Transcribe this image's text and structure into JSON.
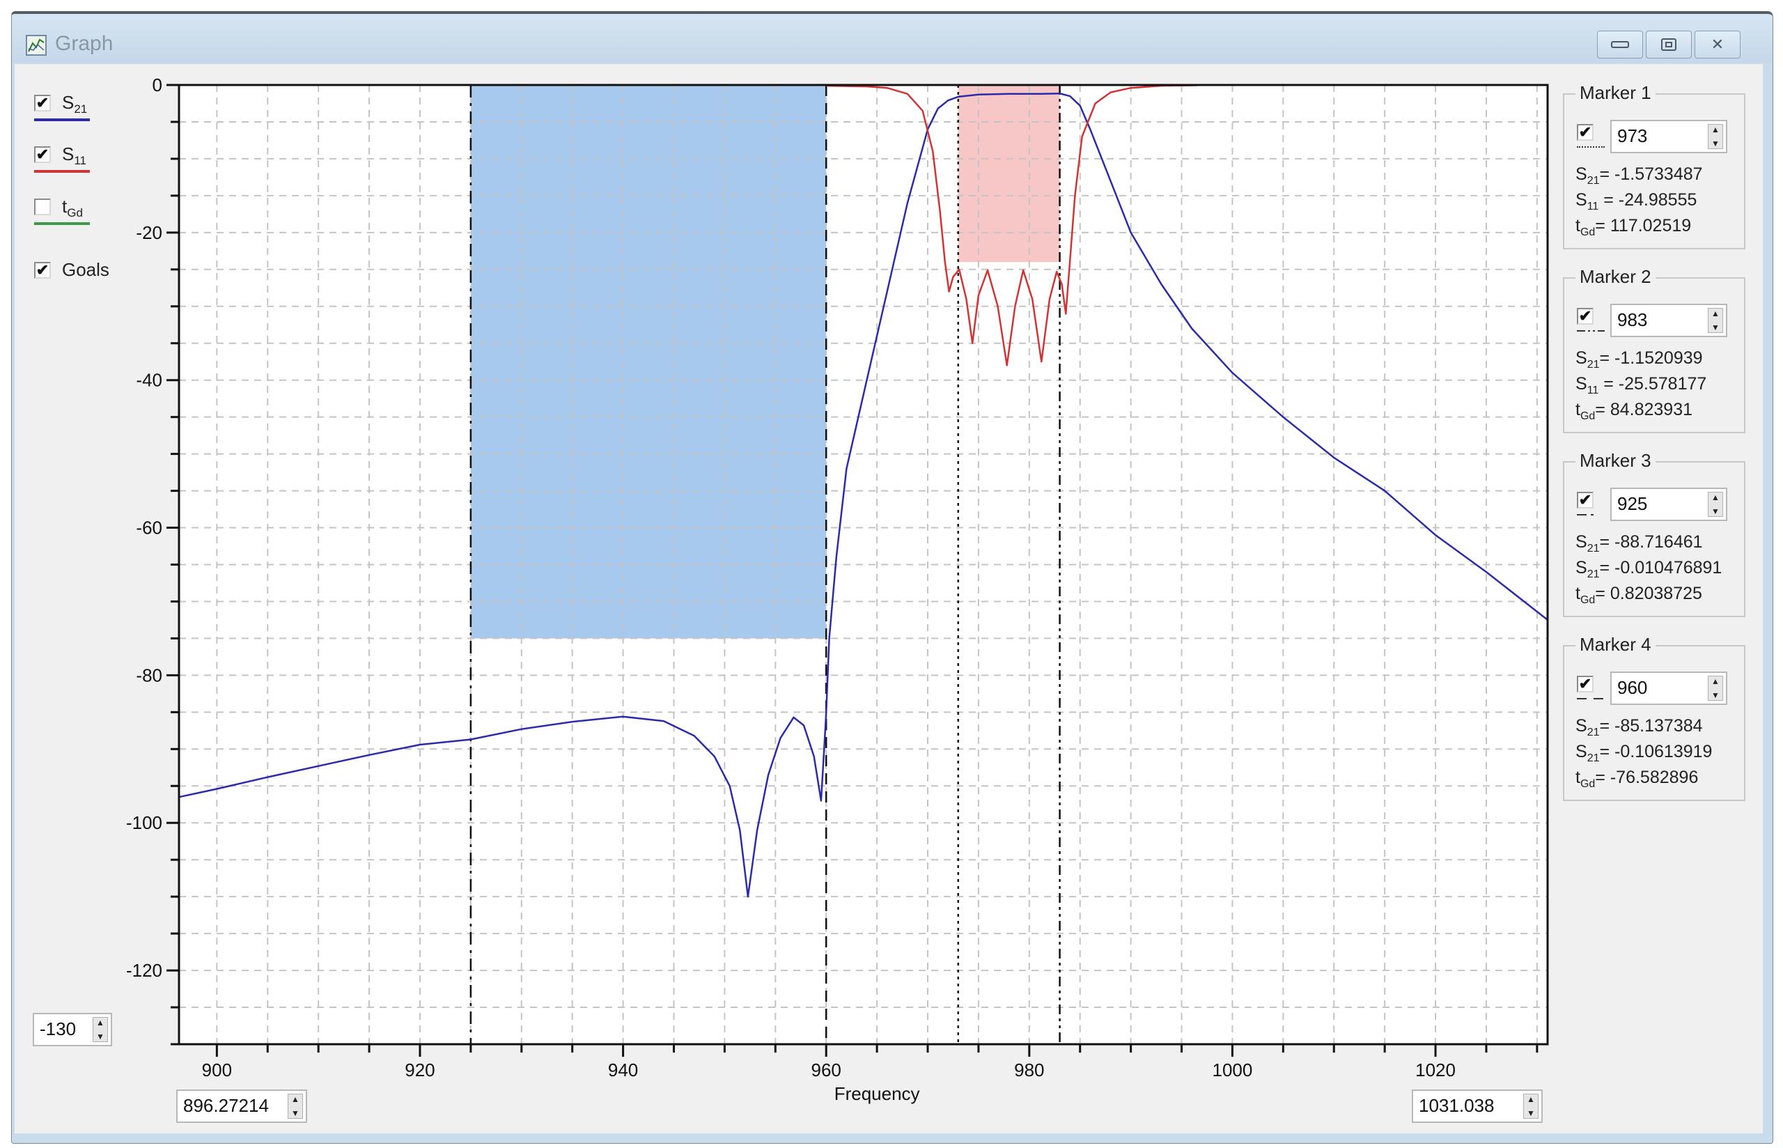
{
  "window": {
    "title": "Graph",
    "icon": "graph-chart-icon",
    "controls": {
      "minimize": "minimize-icon",
      "maximize": "maximize-icon",
      "close": "close-icon"
    }
  },
  "legend": [
    {
      "label": "S",
      "sub": "21",
      "checked": true,
      "color": "#2b2ba8"
    },
    {
      "label": "S",
      "sub": "11",
      "checked": true,
      "color": "#d03434"
    },
    {
      "label": "t",
      "sub": "Gd",
      "checked": false,
      "color": "#3a9a4a"
    },
    {
      "label": "Goals",
      "sub": "",
      "checked": true,
      "color": ""
    }
  ],
  "check_glyph": "✔",
  "axis_controls": {
    "y_min": "-130",
    "x_min": "896.27214",
    "x_max": "1031.038",
    "spin_up": "▲",
    "spin_down": "▼"
  },
  "markers": [
    {
      "title": "Marker 1",
      "checked": true,
      "value": "973",
      "dash": "dotted",
      "rows": [
        {
          "name": "S",
          "sub": "21",
          "text": "= -1.5733487"
        },
        {
          "name": "S",
          "sub": "11",
          "text": " = -24.98555"
        },
        {
          "name": "t",
          "sub": "Gd",
          "text": "= 117.02519"
        }
      ]
    },
    {
      "title": "Marker 2",
      "checked": true,
      "value": "983",
      "dash": "dash-dot-dot",
      "rows": [
        {
          "name": "S",
          "sub": "21",
          "text": "= -1.1520939"
        },
        {
          "name": "S",
          "sub": "11",
          "text": " = -25.578177"
        },
        {
          "name": "t",
          "sub": "Gd",
          "text": "= 84.823931"
        }
      ]
    },
    {
      "title": "Marker 3",
      "checked": true,
      "value": "925",
      "dash": "dash-dot",
      "rows": [
        {
          "name": "S",
          "sub": "21",
          "text": "= -88.716461"
        },
        {
          "name": "S",
          "sub": "21",
          "text": "= -0.010476891"
        },
        {
          "name": "t",
          "sub": "Gd",
          "text": "= 0.82038725"
        }
      ]
    },
    {
      "title": "Marker 4",
      "checked": true,
      "value": "960",
      "dash": "dashed",
      "rows": [
        {
          "name": "S",
          "sub": "21",
          "text": "= -85.137384"
        },
        {
          "name": "S",
          "sub": "21",
          "text": "= -0.10613919"
        },
        {
          "name": "t",
          "sub": "Gd",
          "text": "= -76.582896"
        }
      ]
    }
  ],
  "chart_data": {
    "type": "line",
    "title": "",
    "xlabel": "Frequency",
    "ylabel": "",
    "xlim": [
      896.27214,
      1031.038
    ],
    "ylim": [
      -130,
      0
    ],
    "x_ticks": [
      900,
      920,
      940,
      960,
      980,
      1000,
      1020
    ],
    "x_minor_step": 5,
    "y_ticks": [
      0,
      -20,
      -40,
      -60,
      -80,
      -100,
      -120
    ],
    "y_minor_step": 5,
    "grid": true,
    "series": [
      {
        "name": "S21",
        "color": "#2b2ba8",
        "x": [
          896.27,
          900,
          905,
          910,
          915,
          920,
          925,
          930,
          935,
          940,
          944,
          947,
          949,
          950.5,
          951.5,
          952.3,
          953.2,
          954.3,
          955.5,
          956.8,
          957.8,
          958.8,
          959.5,
          959.8,
          960,
          960.3,
          961,
          962,
          964,
          966,
          968,
          970,
          971,
          972,
          973,
          975,
          978,
          981,
          983,
          984,
          985,
          986,
          988,
          990,
          993,
          996,
          1000,
          1005,
          1010,
          1015,
          1020,
          1025,
          1031.04
        ],
        "y": [
          -96.5,
          -95.4,
          -93.8,
          -92.3,
          -90.8,
          -89.4,
          -88.7,
          -87.3,
          -86.3,
          -85.6,
          -86.2,
          -88.2,
          -91,
          -95,
          -101,
          -110,
          -101,
          -93.5,
          -88.5,
          -85.7,
          -86.8,
          -91,
          -97,
          -90,
          -85.1,
          -75,
          -64,
          -52,
          -40,
          -28,
          -16,
          -6,
          -3.2,
          -2.1,
          -1.6,
          -1.3,
          -1.2,
          -1.2,
          -1.15,
          -1.5,
          -2.8,
          -6,
          -13,
          -20,
          -27,
          -33,
          -39,
          -45,
          -50.5,
          -55,
          -61,
          -66,
          -72.5
        ]
      },
      {
        "name": "S11",
        "color": "#d03434",
        "x": [
          960,
          964,
          966,
          968,
          969.5,
          970.5,
          971.2,
          971.7,
          972.1,
          972.5,
          973.1,
          973.8,
          974.4,
          975,
          975.9,
          976.9,
          977.8,
          978.6,
          979.4,
          980.3,
          981.2,
          982,
          982.7,
          983.2,
          983.6,
          984,
          984.5,
          985.2,
          986.5,
          988,
          990,
          993,
          996.5
        ],
        "y": [
          -0.1,
          -0.2,
          -0.4,
          -1.2,
          -3.5,
          -9,
          -17,
          -24,
          -28,
          -26,
          -25,
          -29,
          -35,
          -28.5,
          -25.1,
          -30,
          -38,
          -30,
          -25.1,
          -29,
          -37.5,
          -29,
          -25.3,
          -27,
          -31,
          -24,
          -15,
          -7,
          -2.5,
          -1,
          -0.4,
          -0.1,
          -0.05
        ]
      }
    ],
    "goals": [
      {
        "name": "S21-stopband-goal",
        "x": [
          925,
          960
        ],
        "y": [
          -75,
          0
        ],
        "color": "#a7c9ed"
      },
      {
        "name": "S11-passband-goal",
        "x": [
          973,
          983
        ],
        "y": [
          -24,
          0
        ],
        "color": "#f7c6c6"
      }
    ],
    "marker_lines": [
      {
        "x": 925,
        "style": "dash-dot"
      },
      {
        "x": 960,
        "style": "dashed"
      },
      {
        "x": 973,
        "style": "dotted"
      },
      {
        "x": 983,
        "style": "dash-dot-dot"
      }
    ]
  }
}
